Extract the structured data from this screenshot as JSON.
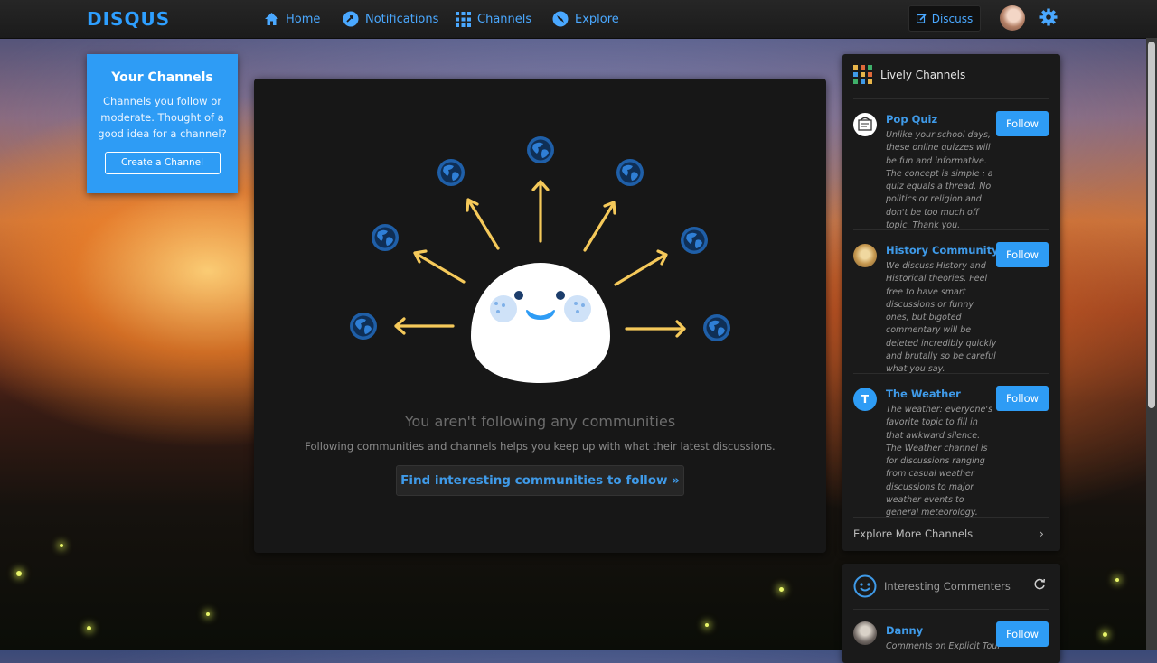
{
  "header": {
    "logo": "DISQUS",
    "nav": [
      {
        "label": "Home",
        "icon": "home-icon"
      },
      {
        "label": "Notifications",
        "icon": "notifications-icon"
      },
      {
        "label": "Channels",
        "icon": "grid-icon"
      },
      {
        "label": "Explore",
        "icon": "compass-icon"
      }
    ],
    "discuss_label": "Discuss"
  },
  "your_channels": {
    "title": "Your Channels",
    "text": "Channels you follow or moderate. Thought of a good idea for a channel?",
    "button": "Create a Channel"
  },
  "main": {
    "empty_title": "You aren't following any communities",
    "empty_sub": "Following communities and channels helps you keep up with what their latest discussions.",
    "find_button": "Find interesting communities to follow »"
  },
  "lively": {
    "title": "Lively Channels",
    "follow_label": "Follow",
    "channels": [
      {
        "name": "Pop Quiz",
        "desc": "Unlike your school days, these online quizzes will be fun and informative. The concept is simple : a quiz equals a thread. No politics or religion and don't be too much off topic. Thank you."
      },
      {
        "name": "History Community",
        "desc": "We discuss History and Historical theories. Feel free to have smart discussions or funny ones, but bigoted commentary will be deleted incredibly quickly and brutally so be careful what you say."
      },
      {
        "name": "The Weather",
        "desc": "The weather: everyone's favorite topic to fill in that awkward silence. The Weather channel is for discussions ranging from casual weather discussions to major weather events to general meteorology.",
        "initial": "T"
      }
    ],
    "explore_more": "Explore More Channels",
    "chevron": "›"
  },
  "commenters": {
    "title": "Interesting Commenters",
    "items": [
      {
        "name": "Danny",
        "desc": "Comments on Explicit Tour",
        "follow": "Follow"
      }
    ]
  },
  "colors": {
    "accent": "#2e9cf5",
    "link": "#3f9ae8",
    "arrow": "#f5c95a",
    "globe": "#1f5fa8"
  }
}
